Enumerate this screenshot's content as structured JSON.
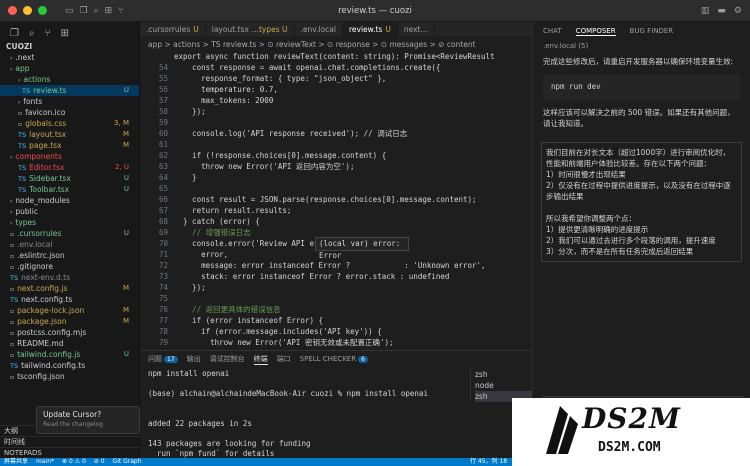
{
  "window": {
    "title": "review.ts — cuozi"
  },
  "colors": {
    "accent": "#007acc",
    "modified": "#c5a84d",
    "untracked": "#73c991",
    "error": "#f14c4c"
  },
  "explorer": {
    "root": "CUOZI",
    "items": [
      {
        "label": ".next",
        "type": "folder",
        "badge": ""
      },
      {
        "label": "app",
        "type": "folder",
        "badge": "",
        "color": "#73c991"
      },
      {
        "label": "actions",
        "type": "folder",
        "badge": "",
        "color": "#73c991"
      },
      {
        "label": "review.ts",
        "type": "ts",
        "badge": "U",
        "selected": true,
        "color": "#73c991"
      },
      {
        "label": "fonts",
        "type": "folder",
        "badge": ""
      },
      {
        "label": "favicon.ico",
        "type": "file",
        "badge": ""
      },
      {
        "label": "globals.css",
        "type": "file",
        "badge": "3, M",
        "color": "#c5a84d"
      },
      {
        "label": "layout.tsx",
        "type": "ts",
        "badge": "M",
        "color": "#c5a84d"
      },
      {
        "label": "page.tsx",
        "type": "ts",
        "badge": "M",
        "color": "#c5a84d"
      },
      {
        "label": "components",
        "type": "folder",
        "badge": "",
        "color": "#f14c4c"
      },
      {
        "label": "Editor.tsx",
        "type": "ts",
        "badge": "2, U",
        "color": "#f14c4c"
      },
      {
        "label": "Sidebar.tsx",
        "type": "ts",
        "badge": "U",
        "color": "#73c991"
      },
      {
        "label": "Toolbar.tsx",
        "type": "ts",
        "badge": "U",
        "color": "#73c991"
      },
      {
        "label": "node_modules",
        "type": "folder",
        "badge": ""
      },
      {
        "label": "public",
        "type": "folder",
        "badge": ""
      },
      {
        "label": "types",
        "type": "folder",
        "badge": "",
        "color": "#73c991"
      },
      {
        "label": ".cursorrules",
        "type": "file",
        "badge": "U",
        "color": "#73c991"
      },
      {
        "label": ".env.local",
        "type": "file",
        "badge": "",
        "color": "#8a8a8a"
      },
      {
        "label": ".eslintrc.json",
        "type": "file",
        "badge": ""
      },
      {
        "label": ".gitignore",
        "type": "file",
        "badge": ""
      },
      {
        "label": "next-env.d.ts",
        "type": "ts",
        "badge": "",
        "color": "#8a8a8a"
      },
      {
        "label": "next.config.js",
        "type": "file",
        "badge": "M",
        "color": "#c5a84d"
      },
      {
        "label": "next.config.ts",
        "type": "ts",
        "badge": ""
      },
      {
        "label": "package-lock.json",
        "type": "file",
        "badge": "M",
        "color": "#c5a84d"
      },
      {
        "label": "package.json",
        "type": "file",
        "badge": "M",
        "color": "#c5a84d"
      },
      {
        "label": "postcss.config.mjs",
        "type": "file",
        "badge": ""
      },
      {
        "label": "README.md",
        "type": "file",
        "badge": ""
      },
      {
        "label": "tailwind.config.js",
        "type": "file",
        "badge": "U",
        "color": "#73c991"
      },
      {
        "label": "tailwind.config.ts",
        "type": "ts",
        "badge": ""
      },
      {
        "label": "tsconfig.json",
        "type": "file",
        "badge": ""
      }
    ],
    "sections": [
      "大纲",
      "时间线",
      "NOTEPADS"
    ],
    "update_title": "Update Cursor?",
    "update_sub": "Read the changelog"
  },
  "tabs": [
    {
      "label": ".cursorrules",
      "mod": "U"
    },
    {
      "label": "layout.tsx",
      "mod": "...types U"
    },
    {
      "label": ".env.local",
      "mod": ""
    },
    {
      "label": "review.ts",
      "mod": "U",
      "active": true
    },
    {
      "label": "next...",
      "mod": ""
    }
  ],
  "breadcrumb": "app > actions > TS review.ts > ⊙ reviewText > ⊙ response > ⊙ messages > ⊘ content",
  "code": [
    {
      "n": "",
      "t": "export async function reviewText(content: string): Promise<ReviewResult[]> {"
    },
    {
      "n": "54",
      "t": "    const response = await openai.chat.completions.create({"
    },
    {
      "n": "55",
      "t": "      response_format: { type: \"json_object\" },"
    },
    {
      "n": "56",
      "t": "      temperature: 0.7,"
    },
    {
      "n": "57",
      "t": "      max_tokens: 2000"
    },
    {
      "n": "58",
      "t": "    });"
    },
    {
      "n": "59",
      "t": ""
    },
    {
      "n": "60",
      "t": "    console.log('API response received'); // 调试日志"
    },
    {
      "n": "61",
      "t": ""
    },
    {
      "n": "62",
      "t": "    if (!response.choices[0].message.content) {"
    },
    {
      "n": "63",
      "t": "      throw new Error('API 返回内容为空');"
    },
    {
      "n": "64",
      "t": "    }"
    },
    {
      "n": "65",
      "t": ""
    },
    {
      "n": "66",
      "t": "    const result = JSON.parse(response.choices[0].message.content);"
    },
    {
      "n": "67",
      "t": "    return result.results;"
    },
    {
      "n": "68",
      "t": "  } catch (error) {"
    },
    {
      "n": "69",
      "t": "    // 增强错误日志"
    },
    {
      "n": "70",
      "t": "    console.error('Review API error details:', {"
    },
    {
      "n": "71",
      "t": "      error,"
    },
    {
      "n": "72",
      "t": "      message: error instanceof Error ?            : 'Unknown error',"
    },
    {
      "n": "73",
      "t": "      stack: error instanceof Error ? error.stack : undefined"
    },
    {
      "n": "74",
      "t": "    });"
    },
    {
      "n": "75",
      "t": ""
    },
    {
      "n": "76",
      "t": "    // 返回更具体的错误信息"
    },
    {
      "n": "77",
      "t": "    if (error instanceof Error) {"
    },
    {
      "n": "78",
      "t": "      if (error.message.includes('API key')) {"
    },
    {
      "n": "79",
      "t": "        throw new Error('API 密钥无效或未配置正确');"
    },
    {
      "n": "80",
      "t": "      } else if (error.message.includes('rate limit')) {"
    },
    {
      "n": "81",
      "t": "        throw new Error('API 调用次数已达上限，请稍后再试');"
    },
    {
      "n": "82",
      "t": "      }"
    },
    {
      "n": "83",
      "t": "    }"
    },
    {
      "n": "84",
      "t": "    throw new Error('文本审阅失败，请稍后重试');"
    },
    {
      "n": "85",
      "t": "  }"
    }
  ],
  "hover": "(local var) error: Error",
  "panel": {
    "tabs": [
      "问题",
      "输出",
      "调试控制台",
      "终端",
      "端口",
      "SPELL CHECKER"
    ],
    "problems_count": "17",
    "spell_count": "6",
    "terminal": [
      "npm install openai",
      "",
      "(base) alchain@alchaindeMacBook-Air cuozi % npm install openai",
      "",
      "",
      "added 22 packages in 2s",
      "",
      "143 packages are looking for funding",
      "  run `npm fund` for details",
      "(base) alchain@alchaindeMacBook-Air cuozi %",
      "(base) alchain@alchaindeMacBook-Air cuozi % |"
    ],
    "terminals": [
      "zsh",
      "node",
      "zsh"
    ]
  },
  "composer": {
    "tabs": [
      "CHAT",
      "COMPOSER",
      "BUG FINDER"
    ],
    "file": ".env.local (5)",
    "intro": "完成这些修改后，请重启开发服务器以确保环境变量生效:",
    "cmd": "npm run dev",
    "after": "这样应该可以解决之前的 500 错误。如果还有其他问题，请让我知道。",
    "box": [
      "我们目前在对长文本（超过1000字）进行审阅优化时，性能和前端用户体验比较差。存在以下两个问题：",
      "1）时间很慢才出现结果",
      "2）仅没有在过程中提供进度提示，以及没有在过程中逐步输出结果",
      "",
      "所以我希望你调整两个点：",
      "1）提供更清晰明确的进度提示",
      "2）我们可以通过去进行多个段落的调用，提升速度",
      "3）分次，而不是在所有任务完成后返回结果"
    ]
  },
  "statusbar": {
    "left": [
      "屏幕共享",
      "main*",
      "⊗ 0 ⚠ 0",
      "⊘ 0",
      "Git Graph"
    ],
    "right": [
      "行 45，列 18"
    ]
  },
  "watermark": {
    "big": "DS2M",
    "small": "DS2M.COM"
  }
}
